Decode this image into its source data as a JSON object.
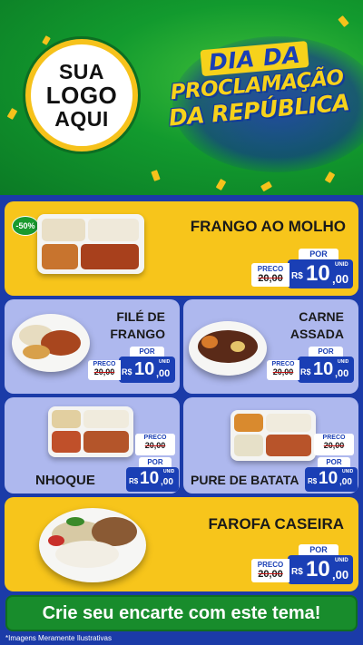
{
  "header": {
    "logo_lines": [
      "SUA",
      "LOGO",
      "AQUI"
    ],
    "title_lines": [
      "DIA DA",
      "PROCLAMAÇÃO",
      "DA REPÚBLICA"
    ]
  },
  "colors": {
    "green": "#129a2e",
    "yellow": "#f7c51b",
    "blue": "#1a3fb5",
    "lavender": "#aeb8ee"
  },
  "products": [
    {
      "name": "FRANGO AO MOLHO",
      "badge": "-50%",
      "price_label": "POR",
      "old_label": "PRECO",
      "old_price": "20,00",
      "old_prefix": "R$",
      "currency": "R$",
      "price_int": "10",
      "price_cents": ",00",
      "unit": "UNID"
    },
    {
      "name_lines": [
        "FILÉ DE",
        "FRANGO"
      ],
      "price_label": "POR",
      "old_label": "PRECO",
      "old_price": "20,00",
      "old_prefix": "R$",
      "currency": "R$",
      "price_int": "10",
      "price_cents": ",00",
      "unit": "UNID"
    },
    {
      "name_lines": [
        "CARNE",
        "ASSADA"
      ],
      "price_label": "POR",
      "old_label": "PRECO",
      "old_price": "20,00",
      "old_prefix": "R$",
      "currency": "R$",
      "price_int": "10",
      "price_cents": ",00",
      "unit": "UNID"
    },
    {
      "name": "NHOQUE",
      "price_label": "POR",
      "old_label": "PRECO",
      "old_price": "20,00",
      "old_prefix": "R$",
      "currency": "R$",
      "price_int": "10",
      "price_cents": ",00",
      "unit": "UNID"
    },
    {
      "name": "PURE DE BATATA",
      "price_label": "POR",
      "old_label": "PRECO",
      "old_price": "20,00",
      "old_prefix": "R$",
      "currency": "R$",
      "price_int": "10",
      "price_cents": ",00",
      "unit": "UNID"
    },
    {
      "name": "FAROFA CASEIRA",
      "price_label": "POR",
      "old_label": "PRECO",
      "old_price": "20,00",
      "old_prefix": "R$",
      "currency": "R$",
      "price_int": "10",
      "price_cents": ",00",
      "unit": "UNID"
    }
  ],
  "cta": "Crie seu encarte com este tema!",
  "footnote": "*Imagens Meramente Ilustrativas"
}
